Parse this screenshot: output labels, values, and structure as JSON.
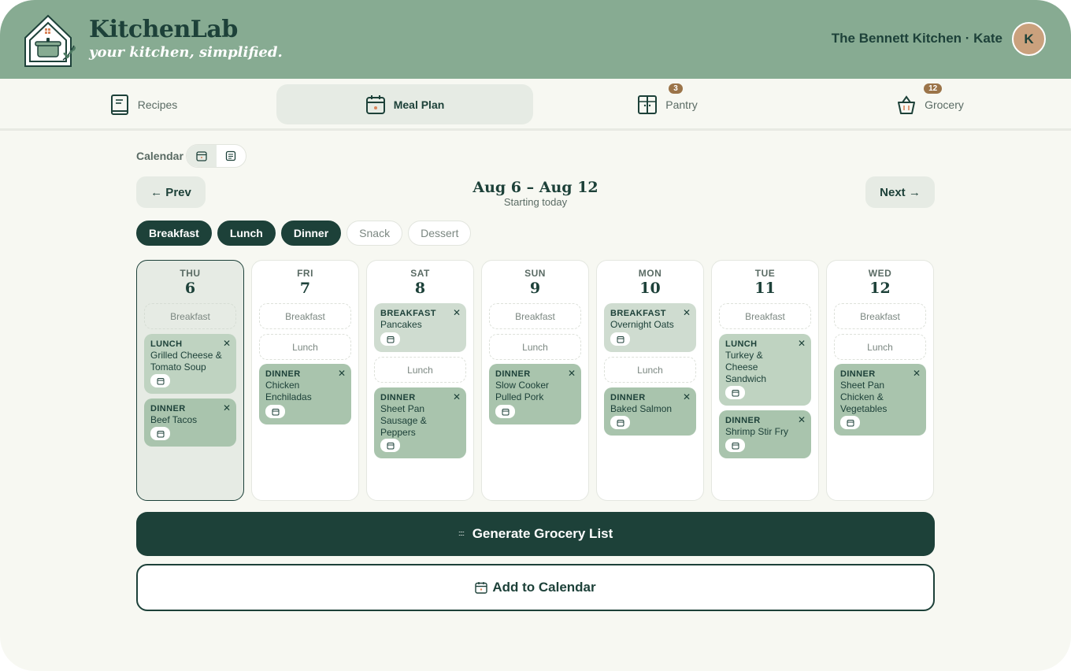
{
  "brand": {
    "title": "KitchenLab",
    "tagline": "your kitchen, simplified.",
    "logo_icon": "house-pot-icon"
  },
  "user": {
    "kitchen_label": "The Bennett Kitchen · Kate",
    "avatar_initial": "K"
  },
  "nav": {
    "recipes": "Recipes",
    "meal_plan": "Meal Plan",
    "pantry": "Pantry",
    "pantry_badge": "3",
    "grocery": "Grocery",
    "grocery_badge": "12",
    "active": "meal_plan"
  },
  "toolbar": {
    "view_label": "Calendar",
    "prev_label": "← Prev",
    "next_label": "Next →",
    "range_title": "Aug 6 – Aug 12",
    "range_subtitle": "Starting today"
  },
  "filters": [
    {
      "label": "Breakfast",
      "on": true
    },
    {
      "label": "Lunch",
      "on": true
    },
    {
      "label": "Dinner",
      "on": true
    },
    {
      "label": "Snack",
      "on": false
    },
    {
      "label": "Dessert",
      "on": false
    }
  ],
  "days": [
    {
      "name": "THU",
      "num": "6",
      "today": true
    },
    {
      "name": "FRI",
      "num": "7"
    },
    {
      "name": "SAT",
      "num": "8"
    },
    {
      "name": "SUN",
      "num": "9"
    },
    {
      "name": "MON",
      "num": "10"
    },
    {
      "name": "TUE",
      "num": "11"
    },
    {
      "name": "WED",
      "num": "12"
    }
  ],
  "slots": {
    "breakfast": "Breakfast",
    "lunch": "Lunch"
  },
  "meals": {
    "thu_lunch": {
      "type": "LUNCH",
      "name": "Grilled Cheese & Tomato Soup"
    },
    "thu_dinner": {
      "type": "DINNER",
      "name": "Beef Tacos"
    },
    "fri_dinner": {
      "type": "DINNER",
      "name": "Chicken Enchiladas"
    },
    "sat_breakfast": {
      "type": "BREAKFAST",
      "name": "Pancakes"
    },
    "sat_dinner": {
      "type": "DINNER",
      "name": "Sheet Pan Sausage & Peppers"
    },
    "sun_dinner": {
      "type": "DINNER",
      "name": "Slow Cooker Pulled Pork"
    },
    "mon_breakfast": {
      "type": "BREAKFAST",
      "name": "Overnight Oats"
    },
    "mon_dinner": {
      "type": "DINNER",
      "name": "Baked Salmon"
    },
    "tue_lunch": {
      "type": "LUNCH",
      "name": "Turkey & Cheese Sandwich"
    },
    "tue_dinner": {
      "type": "DINNER",
      "name": "Shrimp Stir Fry"
    },
    "wed_dinner": {
      "type": "DINNER",
      "name": "Sheet Pan Chicken & Vegetables"
    }
  },
  "remove_glyph": "✕",
  "actions": {
    "generate_label": "Generate Grocery List",
    "add_calendar_label": "Add to Calendar"
  },
  "colors": {
    "header": "#87ab92",
    "primary": "#1d4139",
    "background": "#f7f8f2",
    "meal_card": "#a9c4ad",
    "badge": "#9b7449"
  }
}
